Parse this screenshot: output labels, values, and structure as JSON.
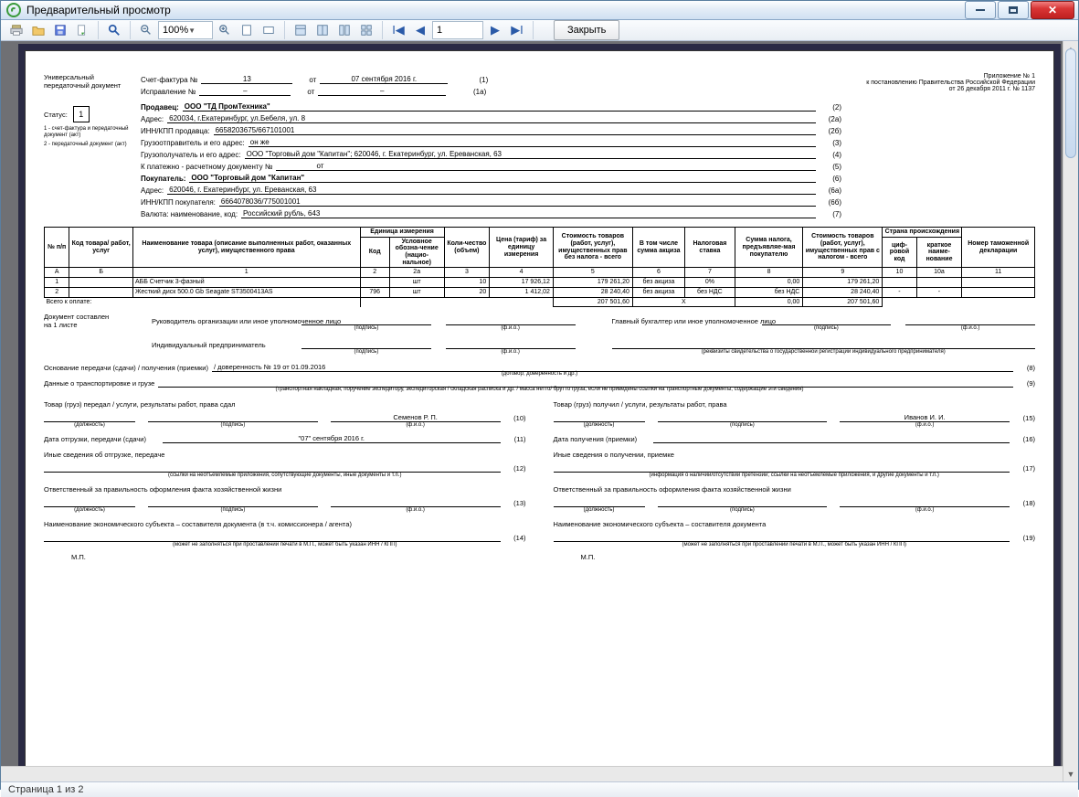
{
  "window": {
    "title": "Предварительный просмотр"
  },
  "toolbar": {
    "zoom": "100%",
    "page": "1",
    "close": "Закрыть"
  },
  "status": "Страница 1 из 2",
  "header": {
    "docname": "Универсальный передаточный документ",
    "status_lbl": "Статус:",
    "status_val": "1",
    "foot1": "1 - счет-фактура и передаточный документ (акт)",
    "foot2": "2 - передаточный документ (акт)",
    "appendix": "Приложение № 1\nк постановлению Правительства Российской Федерации\nот 26 декабря 2011 г. № 1137",
    "inv_lbl": "Счет-фактура №",
    "inv_no": "13",
    "from": "от",
    "inv_date": "07 сентября 2016 г.",
    "inv_n": "(1)",
    "corr_lbl": "Исправление №",
    "corr_no": "–",
    "corr_date": "–",
    "corr_n": "(1а)",
    "seller_lbl": "Продавец:",
    "seller": "ООО \"ТД ПромТехника\"",
    "n2": "(2)",
    "addr_lbl": "Адрес:",
    "seller_addr": "620034, г.Екатеринбург, ул.Бебеля, ул. 8",
    "n2a": "(2а)",
    "inn_lbl": "ИНН/КПП продавца:",
    "seller_inn": "6658203675/667101001",
    "n2b": "(2б)",
    "shipper_lbl": "Грузоотправитель и его адрес:",
    "shipper": "он же",
    "n3": "(3)",
    "consignee_lbl": "Грузополучатель и его адрес:",
    "consignee": "ООО \"Торговый дом \"Капитан\"; 620046, г. Екатеринбург, ул. Ереванская, 63",
    "n4": "(4)",
    "paydoc_lbl": "К платежно - расчетному документу №",
    "paydoc": "от",
    "n5": "(5)",
    "buyer_lbl": "Покупатель:",
    "buyer": "ООО \"Торговый дом \"Капитан\"",
    "n6": "(6)",
    "buyer_addr": "620046, г. Екатеринбург, ул. Ереванская, 63",
    "n6a": "(6а)",
    "binn_lbl": "ИНН/КПП покупателя:",
    "buyer_inn": "6664078036/775001001",
    "n6b": "(6б)",
    "curr_lbl": "Валюта: наименование, код:",
    "curr": "Российский рубль, 643",
    "n7": "(7)"
  },
  "table": {
    "cols": {
      "c1": "№ п/п",
      "c2": "Код товара/ работ, услуг",
      "c3": "Наименование товара (описание выполненных работ, оказанных услуг), имущественного права",
      "unit": "Единица измерения",
      "c4": "Код",
      "c5": "Условное обозна-чение (нацио-нальное)",
      "c6": "Коли-чество (объем)",
      "c7": "Цена (тариф) за единицу измерения",
      "c8": "Стоимость товаров (работ, услуг), имущественных прав без налога - всего",
      "c9": "В том числе сумма акциза",
      "c10": "Налоговая ставка",
      "c11": "Сумма налога, предъявляе-мая покупателю",
      "c12": "Стоимость товаров (работ, услуг), имущественных прав с налогом - всего",
      "c13": "Страна происхождения",
      "c14": "циф-ровой код",
      "c15": "краткое наиме-нование",
      "c16": "Номер таможенной декларации"
    },
    "nums": {
      "a": "А",
      "b": "Б",
      "n1": "1",
      "n2": "2",
      "n2a": "2а",
      "n3": "3",
      "n4": "4",
      "n5": "5",
      "n6": "6",
      "n7": "7",
      "n8": "8",
      "n9": "9",
      "n10": "10",
      "n10a": "10а",
      "n11": "11"
    },
    "rows": [
      {
        "n": "1",
        "code": "",
        "name": "АББ Счетчик 3-фазный",
        "ucode": "",
        "uname": "шт",
        "qty": "10",
        "price": "17 926,12",
        "cost": "179 261,20",
        "excise": "без акциза",
        "rate": "0%",
        "tax": "0,00",
        "total": "179 261,20",
        "c10": "",
        "c10a": "",
        "c11": ""
      },
      {
        "n": "2",
        "code": "",
        "name": "Жесткий диск 500.0 Gb Seagate ST3500413AS",
        "ucode": "796",
        "uname": "шт",
        "qty": "20",
        "price": "1 412,02",
        "cost": "28 240,40",
        "excise": "без акциза",
        "rate": "без НДС",
        "tax": "без НДС",
        "total": "28 240,40",
        "c10": "-",
        "c10a": "-",
        "c11": ""
      }
    ],
    "sum_lbl": "Всего к оплате:",
    "sum_cost": "207 501,60",
    "sum_x": "Х",
    "sum_tax": "0,00",
    "sum_total": "207 501,60"
  },
  "compiled": "Документ составлен на 1 листе",
  "sig": {
    "head": "Руководитель организации или иное уполномоченное лицо",
    "acc": "Главный бухгалтер или иное уполномоченное лицо",
    "ip": "Индивидуальный предприниматель",
    "podpis": "(подпись)",
    "fio": "(ф.и.о.)",
    "rekvhint": "(реквизиты свидетельства о государственной регистрации индивидуального предпринимателя)"
  },
  "bottom": {
    "basis_lbl": "Основание передачи (сдачи) / получения (приемки)",
    "basis": "/ доверенность № 19 от 01.09.2016",
    "n8": "(8)",
    "basis_hint": "(договор; доверенность и др.)",
    "trans_lbl": "Данные о транспортировке и грузе",
    "n9": "(9)",
    "trans_hint": "(транспортная накладная, поручение экспедитору, экспедиторская / складская расписка и др. / масса нетто/ брутто груза, если не приведены ссылки на транспортные документы, содержащие эти сведения)",
    "left": {
      "hand_lbl": "Товар (груз) передал / услуги, результаты работ, права сдал",
      "person": "Семенов Р. П.",
      "n10": "(10)",
      "dol_hint": "(должность)",
      "date_lbl": "Дата отгрузки, передачи (сдачи)",
      "date": "\"07\" сентября 2016 г.",
      "n11": "(11)",
      "other_lbl": "Иные сведения об отгрузке, передаче",
      "n12": "(12)",
      "other_hint": "(ссылки на неотъемлемые приложения, сопутствующие документы, иные документы и т.п.)",
      "resp_lbl": "Ответственный за правильность оформления факта хозяйственной жизни",
      "n13": "(13)",
      "subj_lbl": "Наименование экономического субъекта – составителя документа (в т.ч. комиссионера / агента)",
      "n14": "(14)",
      "subj_hint": "(может не заполняться при проставлении печати в М.П., может быть указан ИНН / КПП)",
      "mp": "М.П."
    },
    "right": {
      "recv_lbl": "Товар (груз) получил / услуги, результаты работ, права",
      "person": "Иванов И. И.",
      "n15": "(15)",
      "date_lbl": "Дата получения (приемки)",
      "n16": "(16)",
      "other_lbl": "Иные сведения о получении, приемке",
      "n17": "(17)",
      "other_hint": "(информация о наличии/отсутствии претензии; ссылки на неотъемлемые приложения, и другие документы и т.п.)",
      "resp_lbl": "Ответственный за правильность оформления факта хозяйственной жизни",
      "n18": "(18)",
      "subj_lbl": "Наименование экономического субъекта – составителя документа",
      "n19": "(19)",
      "subj_hint": "(может не заполняться при проставлении печати в М.П., может быть указан ИНН / КПП)",
      "mp": "М.П."
    }
  }
}
